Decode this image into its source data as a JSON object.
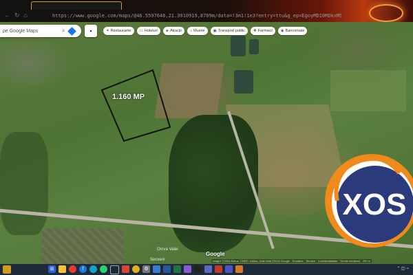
{
  "browser": {
    "url": "https://www.google.com/maps/@46.5597648,21.3910919,8709m/data=!3m1!1e3?entry=ttu&g_ep=EgoyMDI0MDkxMS4wIKXMDSoASAFQAw%3D%3D"
  },
  "maps": {
    "search": {
      "placeholder": "pe Google Maps"
    },
    "chips": [
      {
        "label": "Restaurante",
        "icon": "restaurant-icon"
      },
      {
        "label": "Hoteluri",
        "icon": "hotel-icon"
      },
      {
        "label": "Atracții",
        "icon": "attraction-icon"
      },
      {
        "label": "Muzee",
        "icon": "museum-icon"
      },
      {
        "label": "Transport public",
        "icon": "transit-icon"
      },
      {
        "label": "Farmacii",
        "icon": "pharmacy-icon"
      },
      {
        "label": "Bancomate",
        "icon": "atm-icon"
      }
    ],
    "parcel_label": "1.160 MP",
    "road_label_1": "Orcva Valei",
    "road_label_2": "Secveni",
    "google_logo": "Google",
    "credits": "Imagini ©2024 Airbus, CNES / Airbus, Date hărți ©2024 Google · România · Termeni · Confidențialitate · Trimite feedback · 200 m"
  },
  "watermark": {
    "text": "XOS",
    "colors": {
      "orange": "#f08a1a",
      "navy": "#2a3a7a"
    }
  },
  "taskbar": {
    "icons": [
      "search-icon",
      "folder-icon",
      "chrome-icon",
      "facebook-icon",
      "edge-icon",
      "whatsapp-icon",
      "steam-icon",
      "mail-icon",
      "chrome-icon",
      "settings-icon",
      "store-icon",
      "word-icon",
      "excel-icon",
      "photos-icon",
      "terminal-icon",
      "ai-icon",
      "media-icon",
      "teams-icon",
      "calendar-icon"
    ]
  }
}
